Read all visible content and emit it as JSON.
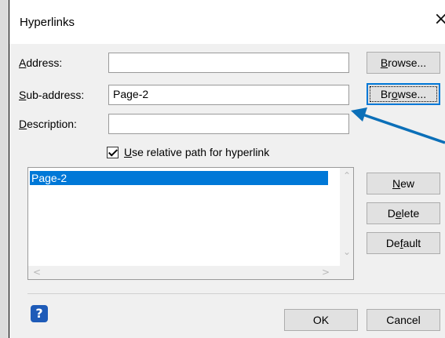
{
  "window": {
    "title": "Hyperlinks",
    "close_glyph": "×"
  },
  "form": {
    "address_label_u": "A",
    "address_label_rest": "ddress:",
    "address_value": "",
    "subaddress_label_u": "S",
    "subaddress_label_rest": "ub-address:",
    "subaddress_value": "Page-2",
    "description_label_u": "D",
    "description_label_rest": "escription:",
    "description_value": "",
    "browse1_u": "B",
    "browse1_rest": "rowse...",
    "browse2_pre": "Br",
    "browse2_u": "o",
    "browse2_rest": "wse...",
    "relative_u": "U",
    "relative_rest": "se relative path for hyperlink",
    "relative_checked": true
  },
  "list": {
    "items": [
      "Page-2"
    ]
  },
  "side_buttons": {
    "new_u": "N",
    "new_rest": "ew",
    "delete_pre": "D",
    "delete_u": "e",
    "delete_rest": "lete",
    "default_pre": "De",
    "default_u": "f",
    "default_rest": "ault"
  },
  "footer": {
    "ok": "OK",
    "cancel": "Cancel",
    "help_glyph": "?"
  },
  "colors": {
    "accent": "#0078d7",
    "arrow": "#0b6fb8",
    "help": "#1e5bb8"
  }
}
